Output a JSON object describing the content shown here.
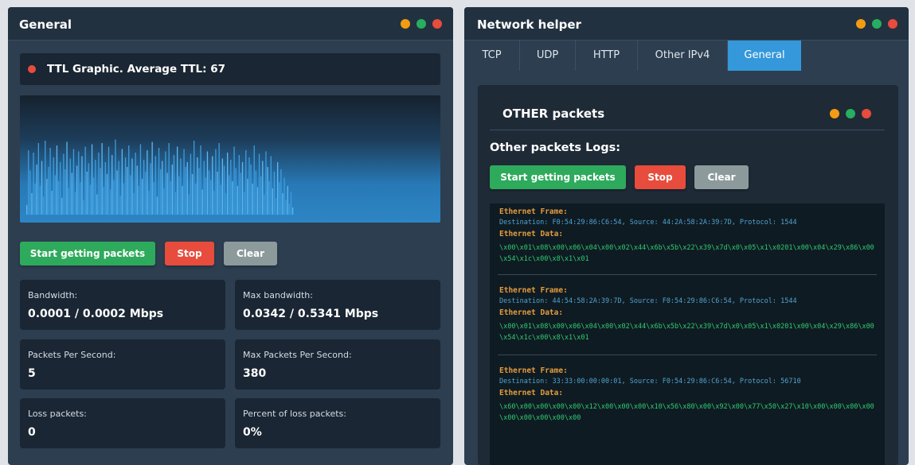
{
  "left_panel": {
    "title": "General",
    "ttl": {
      "text": "TTL Graphic. Average TTL: 67"
    },
    "buttons": {
      "start": "Start getting packets",
      "stop": "Stop",
      "clear": "Clear"
    },
    "stats": [
      {
        "label": "Bandwidth:",
        "value": "0.0001 / 0.0002 Mbps"
      },
      {
        "label": "Max bandwidth:",
        "value": "0.0342 / 0.5341 Mbps"
      },
      {
        "label": "Packets Per Second:",
        "value": "5"
      },
      {
        "label": "Max Packets Per Second:",
        "value": "380"
      },
      {
        "label": "Loss packets:",
        "value": "0"
      },
      {
        "label": "Percent of loss packets:",
        "value": "0%"
      }
    ]
  },
  "right_panel": {
    "title": "Network helper",
    "tabs": [
      {
        "label": "TCP"
      },
      {
        "label": "UDP"
      },
      {
        "label": "HTTP"
      },
      {
        "label": "Other IPv4"
      },
      {
        "label": "General",
        "active": true
      }
    ],
    "card": {
      "title": "OTHER packets",
      "logs_title": "Other packets Logs:",
      "buttons": {
        "start": "Start getting packets",
        "stop": "Stop",
        "clear": "Clear"
      },
      "logs": [
        {
          "frame_label": "Ethernet Frame:",
          "destination_line": "Destination: F0:54:29:86:C6:54, Source: 44:2A:58:2A:39:7D, Protocol: 1544",
          "data_label": "Ethernet Data:",
          "data": "\\x00\\x01\\x08\\x00\\x06\\x04\\x00\\x02\\x44\\x6b\\x5b\\x22\\x39\\x7d\\x0\\x05\\x1\\x0201\\x00\\x04\\x29\\x86\\x00\\x54\\x1c\\x00\\x8\\x1\\x01"
        },
        {
          "frame_label": "Ethernet Frame:",
          "destination_line": "Destination: 44:54:58:2A:39:7D, Source: F0:54:29:86:C6:54, Protocol: 1544",
          "data_label": "Ethernet Data:",
          "data": "\\x00\\x01\\x08\\x00\\x06\\x04\\x00\\x02\\x44\\x6b\\x5b\\x22\\x39\\x7d\\x0\\x05\\x1\\x0201\\x00\\x04\\x29\\x86\\x00\\x54\\x1c\\x00\\x8\\x1\\x01"
        },
        {
          "frame_label": "Ethernet Frame:",
          "destination_line": "Destination: 33:33:00:00:00:01, Source: F0:54:29:86:C6:54, Protocol: 56710",
          "data_label": "Ethernet Data:",
          "data": "\\x60\\x00\\x00\\x00\\x00\\x12\\x00\\x00\\x00\\x10\\x56\\x80\\x00\\x92\\x00\\x77\\x50\\x27\\x10\\x00\\x00\\x00\\x00\\x00\\x00\\x00\\x00\\x00"
        }
      ]
    }
  },
  "colors": {
    "panel_bg": "#2c3e50",
    "accent_blue": "#3498db",
    "green": "#2eaa5c",
    "red": "#e74c3c",
    "gray": "#8d9a9b",
    "log_orange": "#e39b3f",
    "log_blue": "#4fa3d1",
    "log_green": "#2ecc71"
  },
  "icons": {
    "window_dots": [
      "yellow-dot-icon",
      "green-dot-icon",
      "red-dot-icon"
    ],
    "ttl_status": "red-dot-icon"
  },
  "graph_values": [
    8,
    54,
    37,
    18,
    52,
    26,
    42,
    60,
    24,
    45,
    15,
    62,
    30,
    40,
    56,
    20,
    48,
    33,
    58,
    28,
    44,
    14,
    51,
    38,
    61,
    22,
    47,
    35,
    55,
    19,
    41,
    53,
    27,
    49,
    12,
    57,
    36,
    43,
    25,
    59,
    31,
    46,
    17,
    52,
    39,
    60,
    23,
    44,
    34,
    57,
    21,
    50,
    29,
    63,
    37,
    45,
    16,
    55,
    26,
    48,
    40,
    58,
    33,
    47,
    18,
    52,
    41,
    24,
    59,
    30,
    46,
    36,
    54,
    20,
    43,
    61,
    27,
    49,
    15,
    56,
    38,
    45,
    22,
    53,
    35,
    60,
    28,
    42,
    50,
    19,
    57,
    32,
    47,
    24,
    55,
    40,
    44,
    17,
    51,
    34,
    62,
    26,
    48,
    39,
    58,
    21,
    45,
    31,
    53,
    37,
    29,
    49,
    20,
    55,
    36,
    60,
    25,
    47,
    41,
    18,
    52,
    33,
    46,
    28,
    57,
    39,
    24,
    50,
    35,
    44,
    19,
    54,
    30,
    48,
    42,
    26,
    58,
    37,
    23,
    51,
    32,
    45,
    17,
    53,
    40,
    28,
    49,
    22,
    36,
    14,
    44,
    27,
    38,
    18,
    31,
    12,
    24,
    9,
    19,
    6
  ]
}
